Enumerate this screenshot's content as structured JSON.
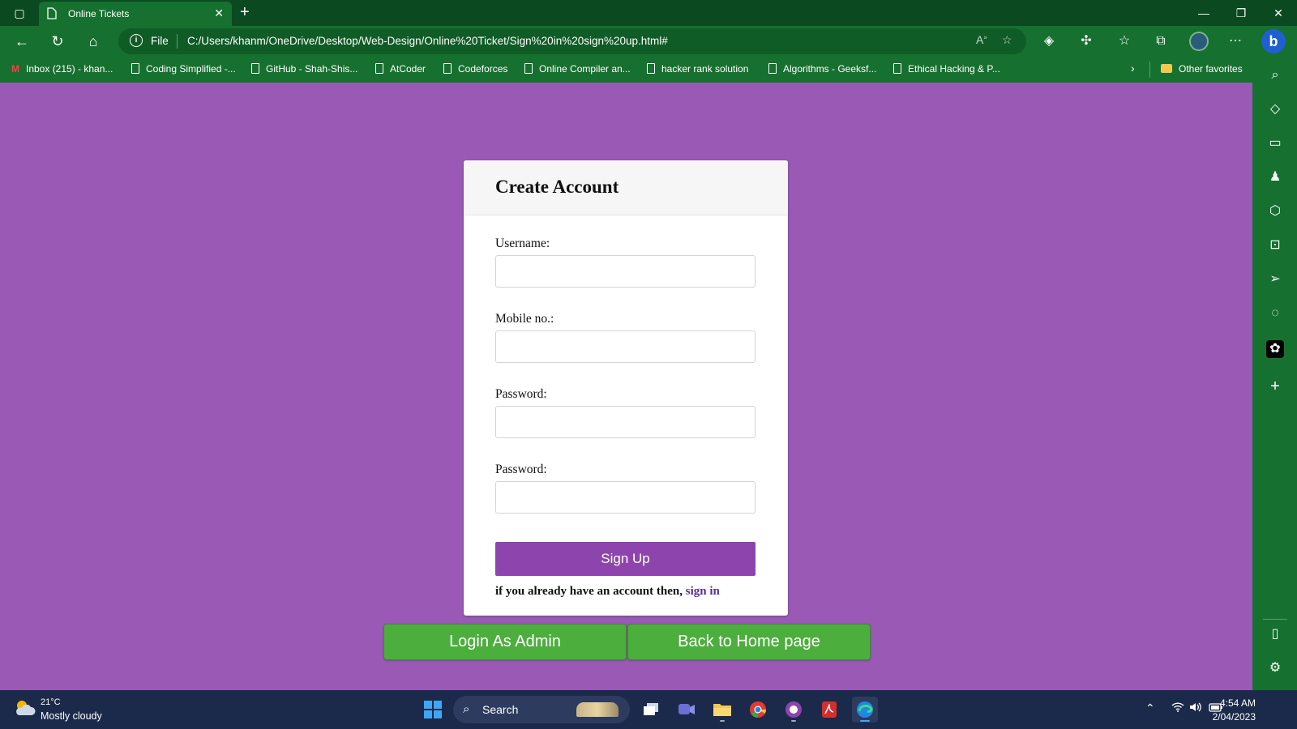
{
  "browser": {
    "tab_title": "Online Tickets",
    "address": {
      "scheme_label": "File",
      "url": "C:/Users/khanm/OneDrive/Desktop/Web-Design/Online%20Ticket/Sign%20in%20sign%20up.html#"
    },
    "bookmarks": [
      "Inbox (215) - khan...",
      "Coding Simplified -...",
      "GitHub - Shah-Shis...",
      "AtCoder",
      "Codeforces",
      "Online Compiler an...",
      "hacker rank solution",
      "Algorithms - Geeksf...",
      "Ethical Hacking & P..."
    ],
    "other_favorites": "Other favorites"
  },
  "form": {
    "title": "Create Account",
    "fields": [
      {
        "label": "Username:",
        "value": ""
      },
      {
        "label": "Mobile no.:",
        "value": ""
      },
      {
        "label": "Password:",
        "value": ""
      },
      {
        "label": "Password:",
        "value": ""
      }
    ],
    "submit_label": "Sign Up",
    "signin_prompt": "if you already have an account then, ",
    "signin_link": "sign in"
  },
  "actions": {
    "admin_label": "Login As Admin",
    "home_label": "Back to Home page"
  },
  "taskbar": {
    "weather_temp": "21°C",
    "weather_desc": "Mostly cloudy",
    "search_label": "Search",
    "time": "4:54 AM",
    "date": "2/04/2023"
  },
  "colors": {
    "page_background": "#9b59b6",
    "browser_chrome": "#16702f",
    "signup_button": "#8e44ad",
    "green_buttons": "#4cae3d",
    "link": "#5b2c9a"
  }
}
